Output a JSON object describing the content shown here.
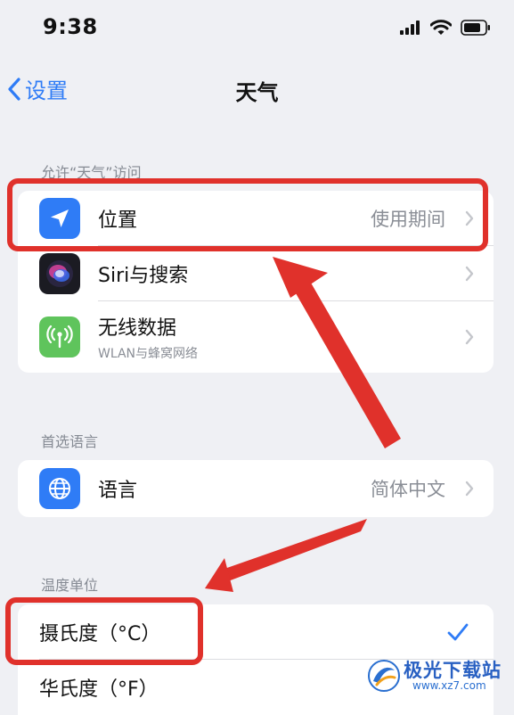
{
  "status_bar": {
    "time": "9:38"
  },
  "nav": {
    "back_label": "设置",
    "title": "天气"
  },
  "sections": {
    "access": {
      "header": "允许“天气”访问",
      "items": [
        {
          "label": "位置",
          "value": "使用期间",
          "icon": "location-arrow-icon",
          "icon_color": "#2f7cf6"
        },
        {
          "label": "Siri与搜索",
          "icon": "siri-icon"
        },
        {
          "label": "无线数据",
          "sublabel": "WLAN与蜂窝网络",
          "icon": "antenna-icon",
          "icon_color": "#5fc45c"
        }
      ]
    },
    "language": {
      "header": "首选语言",
      "items": [
        {
          "label": "语言",
          "value": "简体中文",
          "icon": "globe-icon",
          "icon_color": "#2f7cf6"
        }
      ]
    },
    "temperature": {
      "header": "温度单位",
      "items": [
        {
          "label": "摄氏度（°C）",
          "selected": true
        },
        {
          "label": "华氏度（°F）",
          "selected": false
        }
      ]
    }
  },
  "watermark": {
    "text": "极光下载站",
    "url": "www.xz7.com"
  },
  "colors": {
    "accent": "#2f7cf6",
    "highlight": "#e0312b",
    "background": "#eff0f4"
  }
}
